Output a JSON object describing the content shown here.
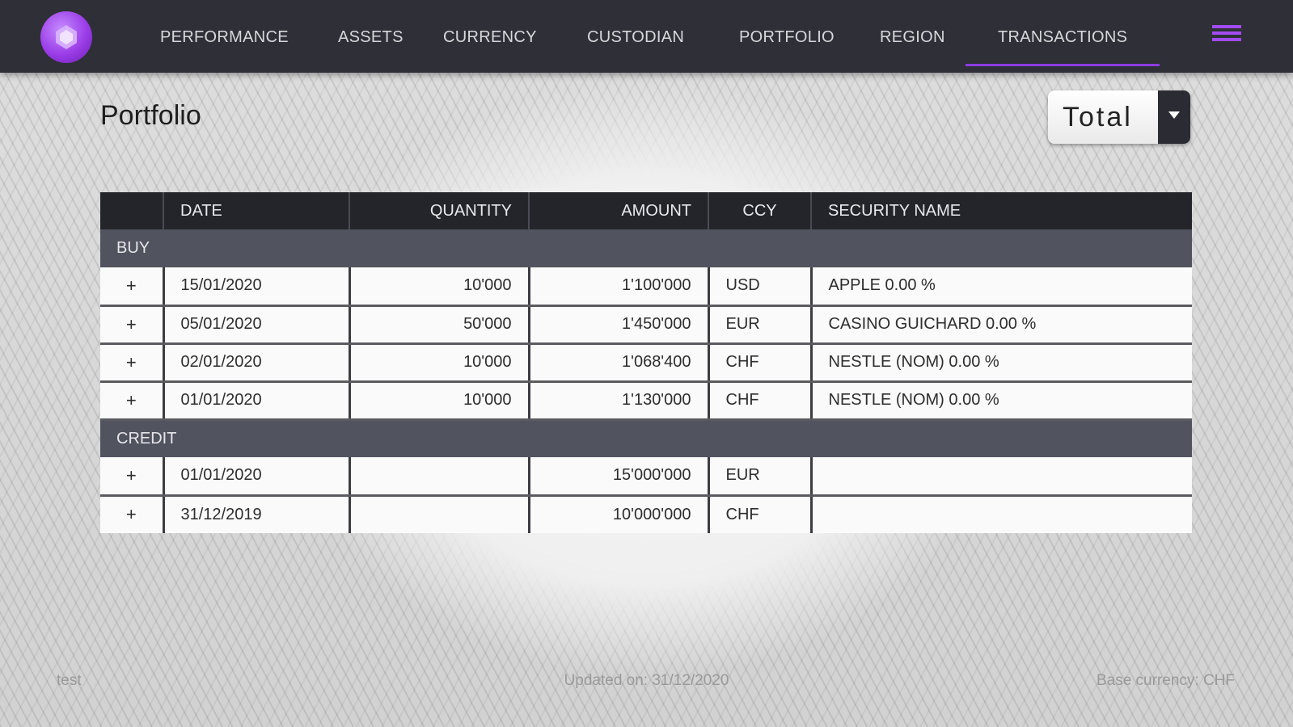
{
  "app": {
    "logo_icon": "gem-icon",
    "accent_color": "#8c3de0"
  },
  "nav": {
    "items": [
      {
        "label": "PERFORMANCE"
      },
      {
        "label": "ASSETS"
      },
      {
        "label": "CURRENCY"
      },
      {
        "label": "CUSTODIAN"
      },
      {
        "label": "PORTFOLIO"
      },
      {
        "label": "REGION"
      },
      {
        "label": "TRANSACTIONS",
        "active": true
      }
    ],
    "menu_icon": "hamburger-icon"
  },
  "page": {
    "title": "Portfolio"
  },
  "selector": {
    "value": "Total",
    "icon": "chevron-down-icon"
  },
  "table": {
    "columns": [
      "",
      "DATE",
      "QUANTITY",
      "AMOUNT",
      "CCY",
      "SECURITY NAME"
    ],
    "groups": [
      {
        "name": "BUY",
        "rows": [
          {
            "toggle": "+",
            "date": "15/01/2020",
            "quantity": "10'000",
            "amount": "1'100'000",
            "ccy": "USD",
            "security": "APPLE 0.00 %"
          },
          {
            "toggle": "+",
            "date": "05/01/2020",
            "quantity": "50'000",
            "amount": "1'450'000",
            "ccy": "EUR",
            "security": "CASINO GUICHARD 0.00 %"
          },
          {
            "toggle": "+",
            "date": "02/01/2020",
            "quantity": "10'000",
            "amount": "1'068'400",
            "ccy": "CHF",
            "security": "NESTLE (NOM) 0.00 %"
          },
          {
            "toggle": "+",
            "date": "01/01/2020",
            "quantity": "10'000",
            "amount": "1'130'000",
            "ccy": "CHF",
            "security": "NESTLE (NOM) 0.00 %"
          }
        ]
      },
      {
        "name": "CREDIT",
        "rows": [
          {
            "toggle": "+",
            "date": "01/01/2020",
            "quantity": "",
            "amount": "15'000'000",
            "ccy": "EUR",
            "security": ""
          },
          {
            "toggle": "+",
            "date": "31/12/2019",
            "quantity": "",
            "amount": "10'000'000",
            "ccy": "CHF",
            "security": ""
          }
        ]
      }
    ]
  },
  "footer": {
    "left": "test",
    "middle": "Updated on: 31/12/2020",
    "right": "Base currency: CHF"
  }
}
